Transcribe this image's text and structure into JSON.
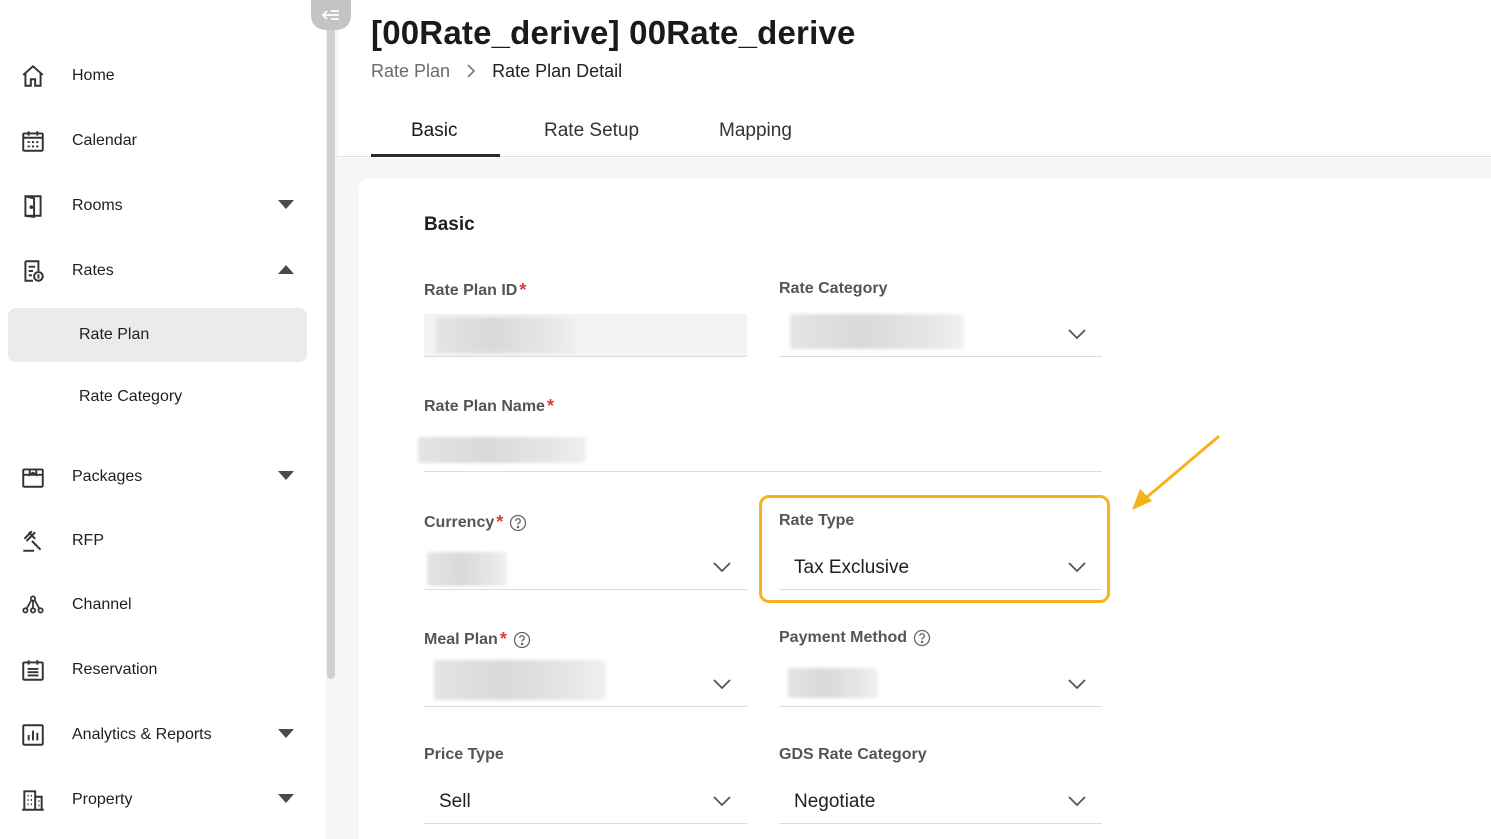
{
  "sidebar": {
    "items": [
      {
        "label": "Home",
        "icon": "home-icon"
      },
      {
        "label": "Calendar",
        "icon": "calendar-icon"
      },
      {
        "label": "Rooms",
        "icon": "door-icon"
      },
      {
        "label": "Rates",
        "icon": "rates-document-icon"
      },
      {
        "label": "Packages",
        "icon": "package-icon"
      },
      {
        "label": "RFP",
        "icon": "gavel-icon"
      },
      {
        "label": "Channel",
        "icon": "channel-network-icon"
      },
      {
        "label": "Reservation",
        "icon": "reservation-list-icon"
      },
      {
        "label": "Analytics & Reports",
        "icon": "analytics-chart-icon"
      },
      {
        "label": "Property",
        "icon": "building-icon"
      }
    ],
    "rates_sub": [
      {
        "label": "Rate Plan",
        "active": true
      },
      {
        "label": "Rate Category",
        "active": false
      }
    ]
  },
  "header": {
    "title": "[00Rate_derive] 00Rate_derive",
    "breadcrumb": {
      "parent": "Rate Plan",
      "current": "Rate Plan Detail"
    }
  },
  "tabs": [
    {
      "label": "Basic",
      "active": true
    },
    {
      "label": "Rate Setup",
      "active": false
    },
    {
      "label": "Mapping",
      "active": false
    }
  ],
  "form": {
    "section_title": "Basic",
    "rate_plan_id": {
      "label": "Rate Plan ID",
      "required": "*"
    },
    "rate_category": {
      "label": "Rate Category"
    },
    "rate_plan_name": {
      "label": "Rate Plan Name",
      "required": "*"
    },
    "currency": {
      "label": "Currency",
      "required": "*"
    },
    "rate_type": {
      "label": "Rate Type",
      "value": "Tax Exclusive"
    },
    "meal_plan": {
      "label": "Meal Plan",
      "required": "*"
    },
    "payment_method": {
      "label": "Payment Method"
    },
    "price_type": {
      "label": "Price Type",
      "value": "Sell"
    },
    "gds_rate_category": {
      "label": "GDS Rate Category",
      "value": "Negotiate"
    }
  },
  "colors": {
    "highlight": "#f6b21b",
    "required": "#e03a3a",
    "active_nav_bg": "#ebebeb"
  }
}
